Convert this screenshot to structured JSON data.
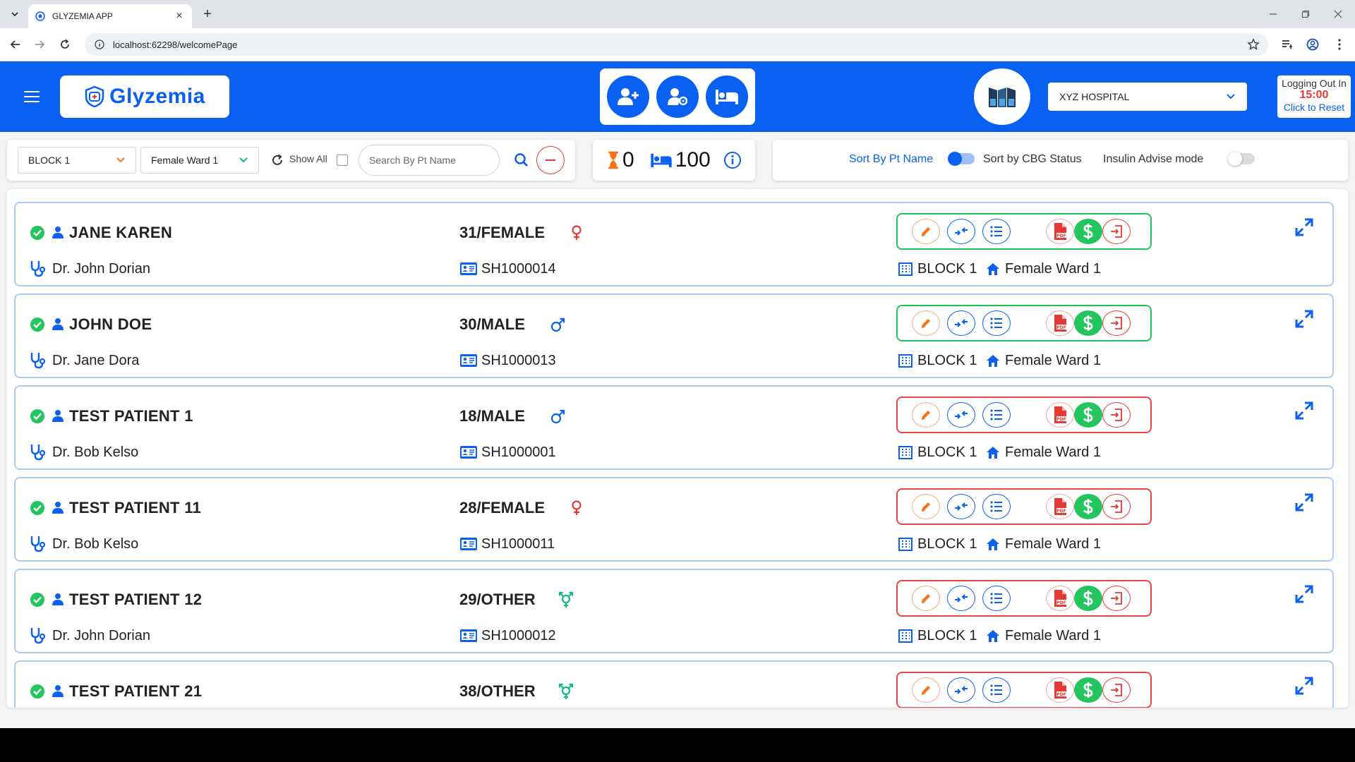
{
  "browser": {
    "tab_title": "GLYZEMIA APP",
    "url": "localhost:62298/welcomePage"
  },
  "header": {
    "logo_text": "Glyzemia",
    "hospital_selected": "XYZ HOSPITAL",
    "logout_label": "Logging Out In",
    "logout_time": "15:00",
    "logout_reset": "Click to Reset"
  },
  "filters": {
    "block_selected": "BLOCK 1",
    "ward_selected": "Female Ward 1",
    "show_all_label": "Show All",
    "search_placeholder": "Search By Pt Name"
  },
  "stats": {
    "pending_count": "0",
    "bed_count": "100"
  },
  "sort": {
    "by_name_label": "Sort By Pt Name",
    "by_cbg_label": "Sort by CBG Status",
    "insulin_label": "Insulin Advise mode"
  },
  "colors": {
    "primary": "#0a60f0",
    "status_ok": "#22c55e",
    "status_alert": "#ef4444",
    "female": "#e53935",
    "male": "#0a60f0",
    "other": "#10b981"
  },
  "patients": [
    {
      "name": "JANE KAREN",
      "age_sex": "31/FEMALE",
      "gender": "female",
      "doctor": "Dr. John Dorian",
      "id": "SH1000014",
      "block": "BLOCK 1",
      "ward": "Female Ward 1",
      "status": "green"
    },
    {
      "name": "JOHN DOE",
      "age_sex": "30/MALE",
      "gender": "male",
      "doctor": "Dr. Jane Dora",
      "id": "SH1000013",
      "block": "BLOCK 1",
      "ward": "Female Ward 1",
      "status": "green"
    },
    {
      "name": "TEST PATIENT 1",
      "age_sex": "18/MALE",
      "gender": "male",
      "doctor": "Dr. Bob Kelso",
      "id": "SH1000001",
      "block": "BLOCK 1",
      "ward": "Female Ward 1",
      "status": "red"
    },
    {
      "name": "TEST PATIENT 11",
      "age_sex": "28/FEMALE",
      "gender": "female",
      "doctor": "Dr. Bob Kelso",
      "id": "SH1000011",
      "block": "BLOCK 1",
      "ward": "Female Ward 1",
      "status": "red"
    },
    {
      "name": "TEST PATIENT 12",
      "age_sex": "29/OTHER",
      "gender": "other",
      "doctor": "Dr. John Dorian",
      "id": "SH1000012",
      "block": "BLOCK 1",
      "ward": "Female Ward 1",
      "status": "red"
    },
    {
      "name": "TEST PATIENT 21",
      "age_sex": "38/OTHER",
      "gender": "other",
      "doctor": "",
      "id": "",
      "block": "",
      "ward": "",
      "status": "red"
    }
  ]
}
